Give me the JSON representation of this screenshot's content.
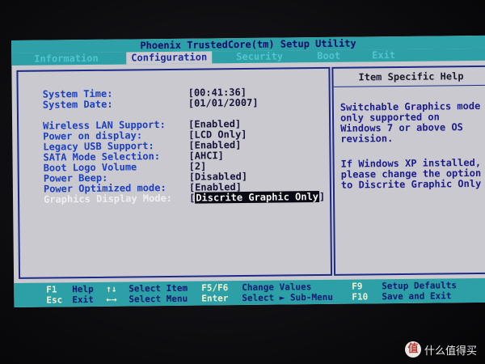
{
  "title": "Phoenix TrustedCore(tm) Setup Utility",
  "menu": [
    "Information",
    "Configuration",
    "Security",
    "Boot",
    "Exit"
  ],
  "active_menu": "Configuration",
  "settings": [
    {
      "label": "System Time:",
      "value": "[00:41:36]"
    },
    {
      "label": "System Date:",
      "value": "[01/01/2007]"
    },
    {
      "label": "Wireless LAN Support:",
      "value": "[Enabled]"
    },
    {
      "label": "Power on display:",
      "value": "[LCD Only]"
    },
    {
      "label": "Legacy USB Support:",
      "value": "[Enabled]"
    },
    {
      "label": "SATA Mode Selection:",
      "value": "[AHCI]"
    },
    {
      "label": "Boot Logo Volume",
      "value": "[2]"
    },
    {
      "label": "Power Beep:",
      "value": "[Disabled]"
    },
    {
      "label": "Power Optimized mode:",
      "value": "[Enabled]"
    },
    {
      "label": "Graphics Display Mode:",
      "value_open": "[",
      "value_highlight": "Discrite Graphic Only",
      "value_close": "]"
    }
  ],
  "help": {
    "title": "Item Specific Help",
    "paragraph1": "Switchable Graphics mode\nonly supported on\nWindows 7 or above OS\nrevision.",
    "paragraph2": "If Windows XP installed,\nplease change the option\nto Discrite Graphic Only"
  },
  "footer": {
    "f1_key": "F1",
    "f1_desc": "Help",
    "updown_key": "↑↓",
    "updown_desc": "Select Item",
    "f5f6_key": "F5/F6",
    "f5f6_desc": "Change Values",
    "f9_key": "F9",
    "f9_desc": "Setup Defaults",
    "esc_key": "Esc",
    "esc_desc": "Exit",
    "leftright_key": "←→",
    "leftright_desc": "Select Menu",
    "enter_key": "Enter",
    "enter_desc": "Select ► Sub-Menu",
    "f10_key": "F10",
    "f10_desc": "Save and Exit"
  },
  "watermark": {
    "logo": "值",
    "text": "什么值得买"
  },
  "colors": {
    "bios_bg": "#c9c9cf",
    "bar": "#2c9fa7",
    "label_blue": "#1b3fc0",
    "panel_border": "#1c2a88"
  }
}
